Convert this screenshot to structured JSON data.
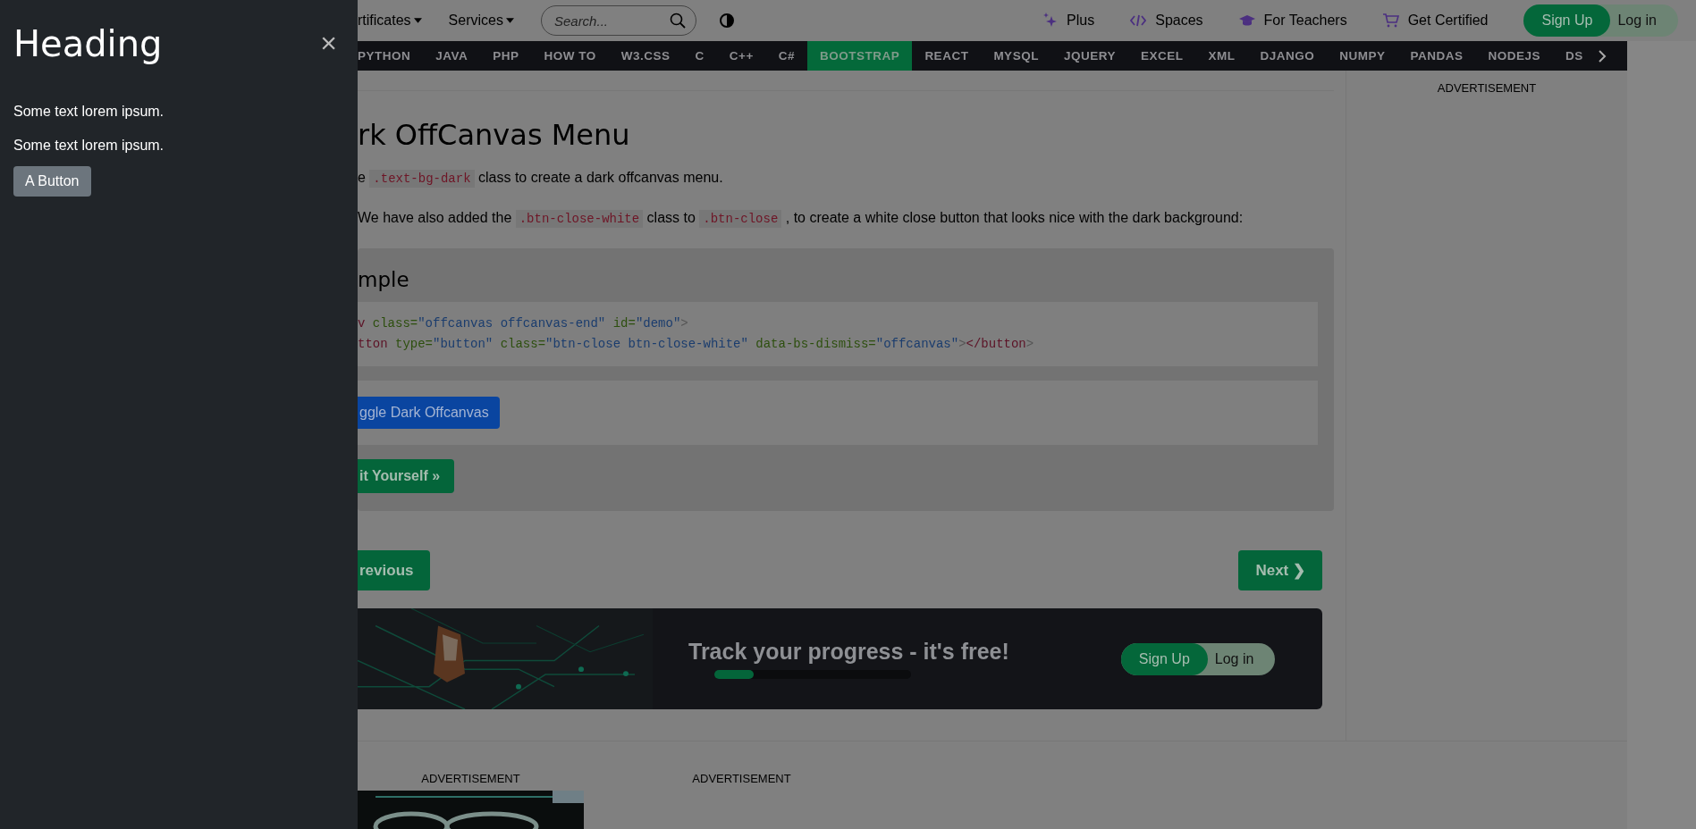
{
  "drawer": {
    "heading": "Heading",
    "close": "×",
    "paragraphs": [
      "Some text lorem ipsum.",
      "Some text lorem ipsum."
    ],
    "button": "A Button"
  },
  "topbar": {
    "menus": [
      {
        "label": "rtificates"
      },
      {
        "label": "Services"
      }
    ],
    "search": {
      "placeholder": "Search..."
    },
    "links": [
      {
        "label": "Plus",
        "kind": "sparkle"
      },
      {
        "label": "Spaces",
        "kind": "code"
      },
      {
        "label": "For Teachers",
        "kind": "cap"
      },
      {
        "label": "Get Certified",
        "kind": "cart"
      }
    ],
    "signup": "Sign Up",
    "login": "Log in"
  },
  "nav": {
    "items": [
      {
        "label": "PYTHON",
        "selected": false
      },
      {
        "label": "JAVA",
        "selected": false
      },
      {
        "label": "PHP",
        "selected": false
      },
      {
        "label": "HOW TO",
        "selected": false
      },
      {
        "label": "W3.CSS",
        "selected": false
      },
      {
        "label": "C",
        "selected": false
      },
      {
        "label": "C++",
        "selected": false
      },
      {
        "label": "C#",
        "selected": false
      },
      {
        "label": "BOOTSTRAP",
        "selected": true
      },
      {
        "label": "REACT",
        "selected": false
      },
      {
        "label": "MYSQL",
        "selected": false
      },
      {
        "label": "JQUERY",
        "selected": false
      },
      {
        "label": "EXCEL",
        "selected": false
      },
      {
        "label": "XML",
        "selected": false
      },
      {
        "label": "DJANGO",
        "selected": false
      },
      {
        "label": "NUMPY",
        "selected": false
      },
      {
        "label": "PANDAS",
        "selected": false
      },
      {
        "label": "NODEJS",
        "selected": false
      },
      {
        "label": "DS",
        "selected": false
      }
    ]
  },
  "article": {
    "title": "rk OffCanvas Menu",
    "paragraphs": [
      [
        {
          "kind": "text",
          "text": "e"
        },
        {
          "kind": "code",
          "text": ".text-bg-dark"
        },
        {
          "kind": "text",
          "text": "class to create a dark offcanvas menu."
        }
      ],
      [
        {
          "kind": "text",
          "text": "We have also added the"
        },
        {
          "kind": "code",
          "text": ".btn-close-white"
        },
        {
          "kind": "text",
          "text": "class to"
        },
        {
          "kind": "code",
          "text": ".btn-close"
        },
        {
          "kind": "text",
          "text": ", to create a white close button that looks nice with the dark background:"
        }
      ]
    ]
  },
  "example": {
    "heading": "mple",
    "code_lines": [
      [
        {
          "kind": "tag",
          "text": "v"
        },
        {
          "kind": "attr",
          "text": " class="
        },
        {
          "kind": "value",
          "text": "\"offcanvas offcanvas-end\""
        },
        {
          "kind": "attr",
          "text": " id="
        },
        {
          "kind": "value",
          "text": "\"demo\""
        },
        {
          "kind": "punct",
          "text": ">"
        }
      ],
      [
        {
          "kind": "tag",
          "text": "tton"
        },
        {
          "kind": "attr",
          "text": " type="
        },
        {
          "kind": "value",
          "text": "\"button\""
        },
        {
          "kind": "attr",
          "text": " class="
        },
        {
          "kind": "value",
          "text": "\"btn-close btn-close-white\""
        },
        {
          "kind": "attr",
          "text": " data-bs-dismiss="
        },
        {
          "kind": "value",
          "text": "\"offcanvas\""
        },
        {
          "kind": "punct",
          "text": ">"
        },
        {
          "kind": "tag",
          "text": "</button"
        },
        {
          "kind": "punct",
          "text": ">"
        }
      ]
    ],
    "toggle_button": "ggle Dark Offcanvas",
    "try_button": "it Yourself »"
  },
  "pager": {
    "previous": "revious",
    "next": "Next ❯"
  },
  "banner": {
    "title": "Track your progress - it's free!",
    "level": 0.2,
    "signup": "Sign Up",
    "login": "Log in"
  },
  "ads": {
    "sidebar": "ADVERTISEMENT",
    "bottom": [
      "ADVERTISEMENT",
      "ADVERTISEMENT"
    ]
  }
}
